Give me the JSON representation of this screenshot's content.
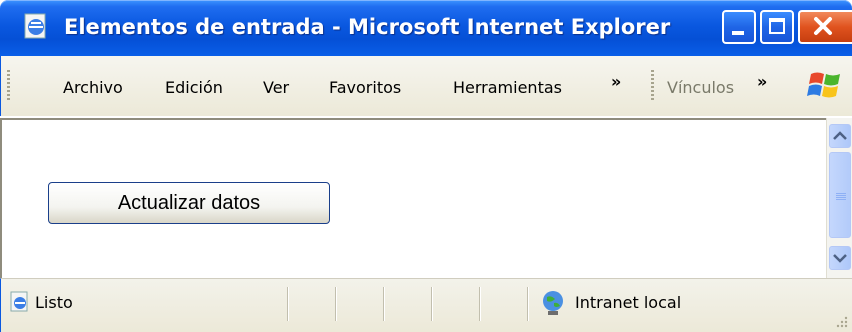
{
  "window": {
    "title": "Elementos de entrada - Microsoft Internet Explorer"
  },
  "menubar": {
    "items": [
      {
        "label": "Archivo"
      },
      {
        "label": "Edición"
      },
      {
        "label": "Ver"
      },
      {
        "label": "Favoritos"
      },
      {
        "label": "Herramientas"
      }
    ],
    "overflow": "»",
    "links_label": "Vínculos",
    "links_overflow": "»"
  },
  "content": {
    "button_label": "Actualizar datos"
  },
  "status": {
    "text": "Listo",
    "zone": "Intranet local"
  },
  "icons": {
    "title": "ie-page-icon",
    "logo": "windows-logo-icon",
    "status_page": "ie-page-icon",
    "zone": "intranet-globe-icon"
  }
}
